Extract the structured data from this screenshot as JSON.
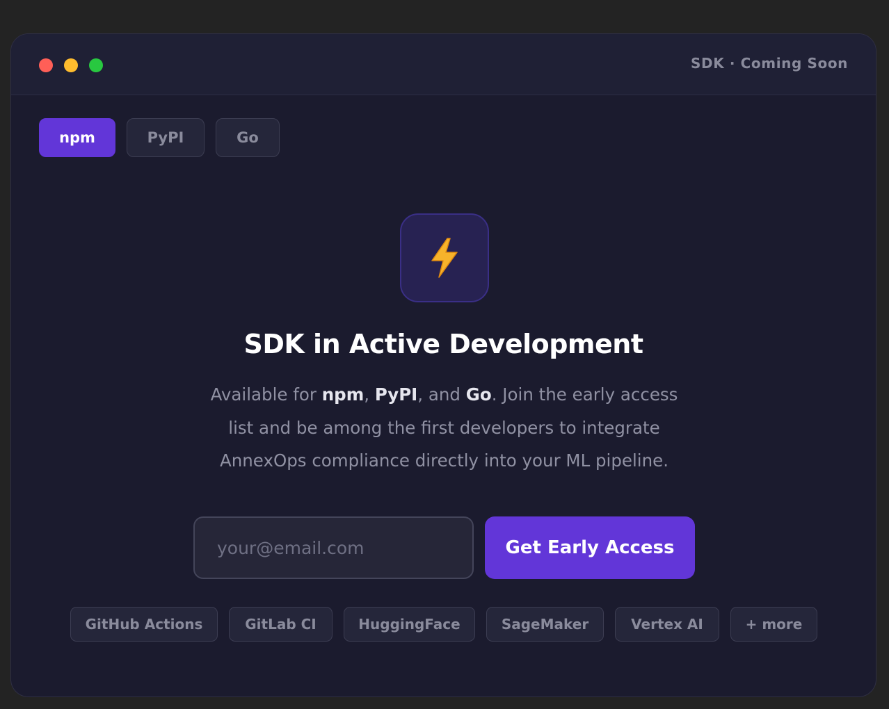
{
  "window": {
    "title": "SDK · Coming Soon",
    "traffic_lights": {
      "close": "#ff5f57",
      "minimize": "#febc2e",
      "zoom": "#28c840"
    }
  },
  "tabs": [
    {
      "label": "npm",
      "active": true
    },
    {
      "label": "PyPI",
      "active": false
    },
    {
      "label": "Go",
      "active": false
    }
  ],
  "hero": {
    "icon": "lightning-bolt-icon",
    "heading": "SDK in Active Development",
    "desc_prefix": "Available for ",
    "desc_npm": "npm",
    "desc_sep1": ", ",
    "desc_pypi": "PyPI",
    "desc_sep2": ", and ",
    "desc_go": "Go",
    "desc_rest": ". Join the early access list and be among the first developers to integrate AnnexOps compliance directly into your ML pipeline."
  },
  "signup": {
    "email_placeholder": "your@email.com",
    "email_value": "",
    "cta_label": "Get Early Access"
  },
  "integrations": [
    "GitHub Actions",
    "GitLab CI",
    "HuggingFace",
    "SageMaker",
    "Vertex AI",
    "+ more"
  ],
  "colors": {
    "accent": "#6236d8",
    "background": "#1b1b2e",
    "icon_bolt": "#f7b32b"
  }
}
